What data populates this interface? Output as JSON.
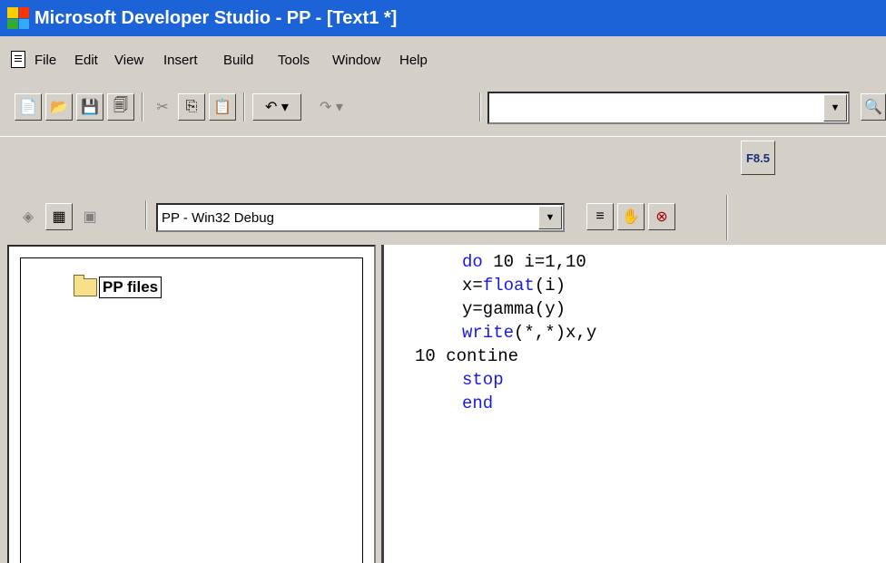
{
  "window": {
    "title": "Microsoft Developer Studio - PP - [Text1 *]"
  },
  "menu": {
    "items": [
      "File",
      "Edit",
      "View",
      "Insert",
      "Build",
      "Tools",
      "Window",
      "Help"
    ]
  },
  "toolbar": {
    "buttons": [
      "new-text-file-icon",
      "open-icon",
      "save-icon",
      "save-all-icon",
      "cut-icon",
      "copy-icon",
      "paste-icon",
      "undo-icon",
      "redo-icon"
    ],
    "find_combo_value": ""
  },
  "build_toolbar": {
    "config": "PP - Win32 Debug",
    "f8_label": "F8.5",
    "buttons": [
      "compile-icon",
      "build-icon",
      "stop-build-icon",
      "go-to-line-icon",
      "breakpoint-hand-icon",
      "remove-breakpoints-icon"
    ]
  },
  "workspace": {
    "project_label": "PP files"
  },
  "editor": {
    "lines": [
      {
        "label": "",
        "keyword": "do",
        "rest": " 10 i=1,10"
      },
      {
        "label": "",
        "keyword": "",
        "rest": "x=",
        "kw2": "float",
        "rest2": "(i)"
      },
      {
        "label": "",
        "keyword": "",
        "rest": "y=gamma(y)"
      },
      {
        "label": "",
        "keyword": "write",
        "rest": "(*,*)x,y"
      },
      {
        "label": "10",
        "keyword": "",
        "rest": "contine"
      },
      {
        "label": "",
        "keyword": "stop",
        "rest": ""
      },
      {
        "label": "",
        "keyword": "end",
        "rest": ""
      }
    ]
  },
  "colors": {
    "title_bar": "#1c63d8",
    "keyword": "#1a1adf",
    "chrome": "#d4d0c8"
  }
}
